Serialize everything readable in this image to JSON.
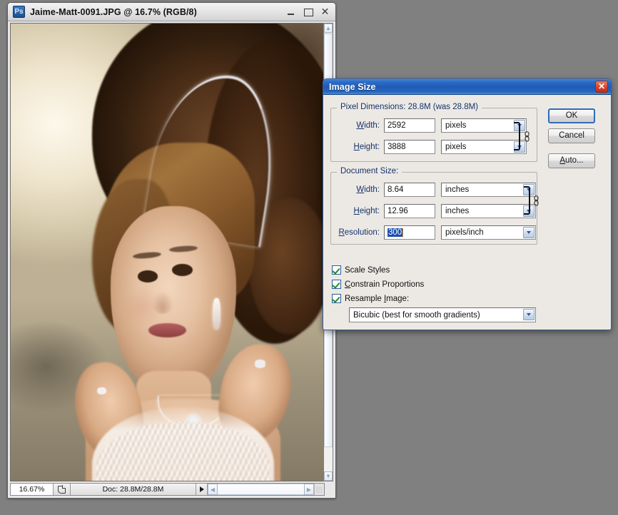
{
  "desktop": {
    "background_color": "#808080"
  },
  "image_window": {
    "app_icon": "photoshop-icon",
    "app_icon_label": "Ps",
    "title": "Jaime-Matt-0091.JPG @ 16.7% (RGB/8)",
    "controls": {
      "minimize": "minimize-icon",
      "maximize": "maximize-icon",
      "close": "close-icon",
      "close_glyph": "✕"
    },
    "statusbar": {
      "zoom_level": "16.67%",
      "doc_icon": "document-icon",
      "doc_info": "Doc: 28.8M/28.8M",
      "menu_arrow": "play-arrow-icon"
    },
    "scrollbars": {
      "up_arrow": "▲",
      "down_arrow": "▼",
      "left_arrow": "◀",
      "right_arrow": "▶",
      "resize_grip": "resize-grip-icon"
    },
    "photo_description": "bride portrait with tiara, necklace and lace dress"
  },
  "dialog": {
    "title": "Image Size",
    "close_glyph": "✕",
    "pixel_dimensions": {
      "legend": "Pixel Dimensions:  28.8M (was 28.8M)",
      "width": {
        "label": "Width:",
        "label_pre": "W",
        "label_key": "i",
        "label_post": "dth:",
        "value": "2592",
        "unit": "pixels"
      },
      "height": {
        "label": "Height:",
        "label_pre": "H",
        "label_key": "e",
        "label_post": "ight:",
        "value": "3888",
        "unit": "pixels"
      },
      "link_icon": "chain-link-icon"
    },
    "document_size": {
      "legend": "Document Size:",
      "width": {
        "label": "Width:",
        "value": "8.64",
        "unit": "inches"
      },
      "height": {
        "label": "Height:",
        "value": "12.96",
        "unit": "inches"
      },
      "resolution": {
        "label": "Resolution:",
        "value": "300",
        "unit": "pixels/inch",
        "selected": true
      },
      "link_icon": "chain-link-icon"
    },
    "options": {
      "scale_styles": {
        "label": "Scale Styles",
        "checked": true
      },
      "constrain_proportions": {
        "label": "Constrain Proportions",
        "checked": true
      },
      "resample_image": {
        "label": "Resample Image:",
        "checked": true
      },
      "resample_method": "Bicubic (best for smooth gradients)"
    },
    "buttons": {
      "ok": "OK",
      "cancel": "Cancel",
      "auto": "Auto..."
    },
    "colors": {
      "titlebar_blue": "#1f5bb5",
      "legend_text": "#16326b",
      "selection_blue": "#1c4fae",
      "check_green": "#1f8b27",
      "close_red": "#d9452c"
    }
  }
}
